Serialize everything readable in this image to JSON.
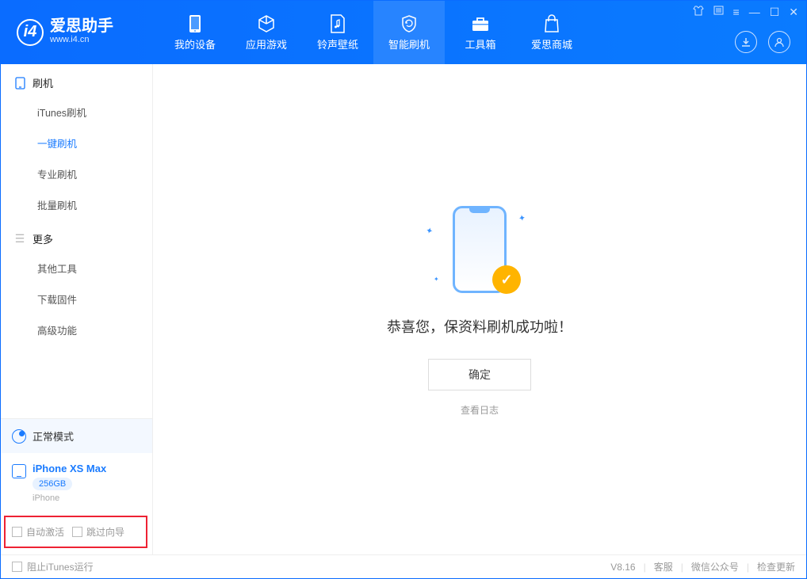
{
  "app": {
    "title": "爱思助手",
    "subtitle": "www.i4.cn"
  },
  "nav": {
    "tabs": [
      {
        "label": "我的设备"
      },
      {
        "label": "应用游戏"
      },
      {
        "label": "铃声壁纸"
      },
      {
        "label": "智能刷机"
      },
      {
        "label": "工具箱"
      },
      {
        "label": "爱思商城"
      }
    ]
  },
  "sidebar": {
    "sections": [
      {
        "title": "刷机",
        "items": [
          {
            "label": "iTunes刷机"
          },
          {
            "label": "一键刷机"
          },
          {
            "label": "专业刷机"
          },
          {
            "label": "批量刷机"
          }
        ]
      },
      {
        "title": "更多",
        "items": [
          {
            "label": "其他工具"
          },
          {
            "label": "下载固件"
          },
          {
            "label": "高级功能"
          }
        ]
      }
    ],
    "mode": {
      "label": "正常模式"
    },
    "device": {
      "name": "iPhone XS Max",
      "storage": "256GB",
      "type": "iPhone"
    },
    "options": {
      "autoActivate": "自动激活",
      "skipGuide": "跳过向导"
    }
  },
  "main": {
    "successTitle": "恭喜您，保资料刷机成功啦！",
    "confirm": "确定",
    "viewLog": "查看日志"
  },
  "footer": {
    "blockItunes": "阻止iTunes运行",
    "version": "V8.16",
    "support": "客服",
    "wechat": "微信公众号",
    "checkUpdate": "检查更新"
  }
}
